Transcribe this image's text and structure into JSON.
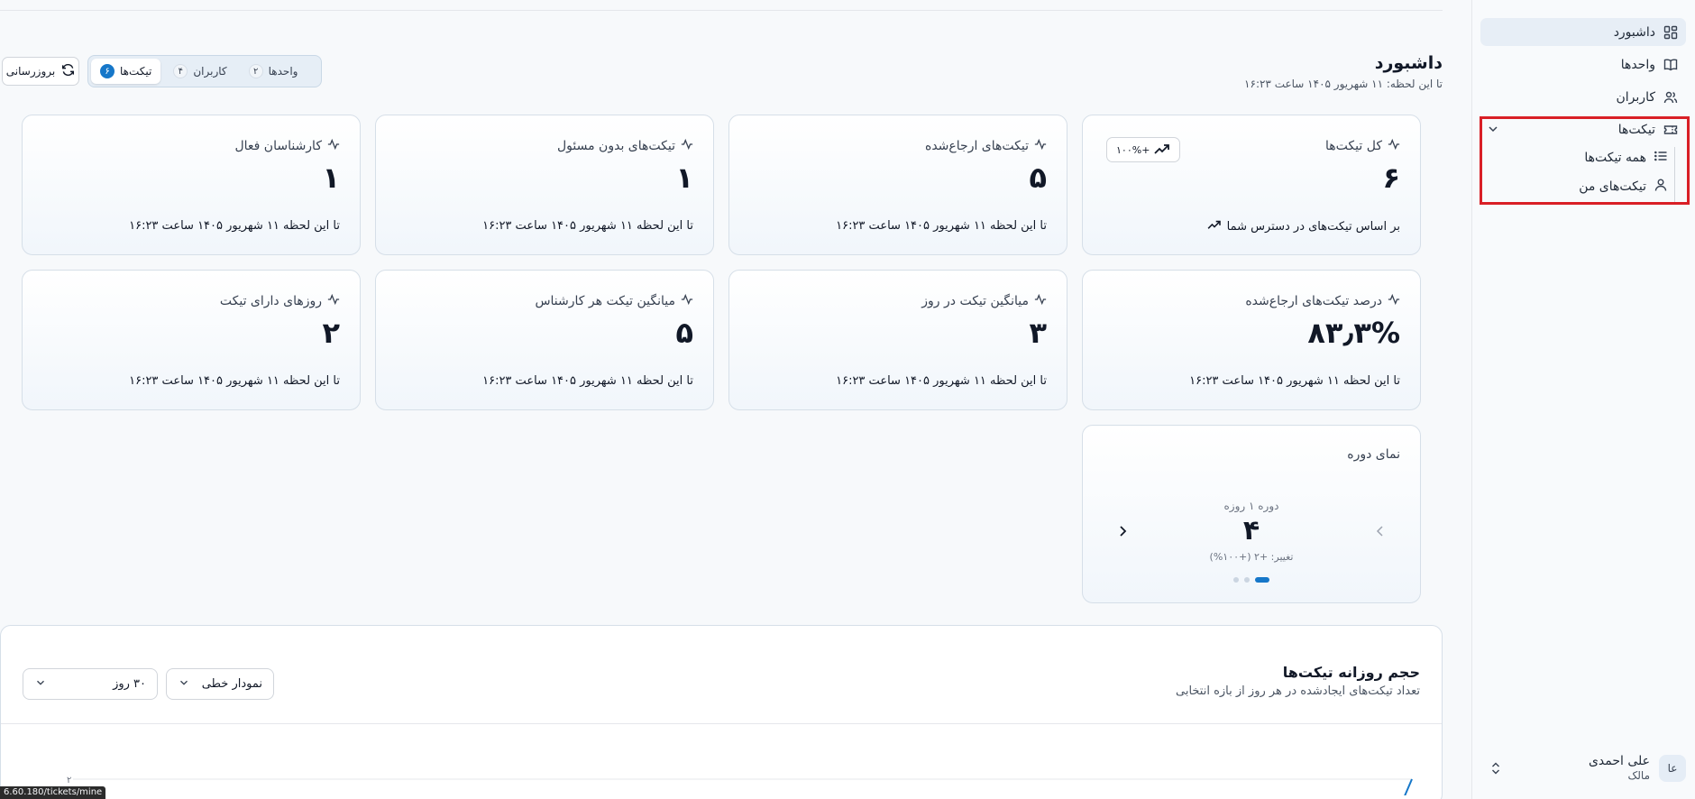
{
  "sidebar": {
    "items": [
      {
        "label": "داشبورد",
        "icon": "dashboard-icon"
      },
      {
        "label": "واحدها",
        "icon": "book-icon"
      },
      {
        "label": "کاربران",
        "icon": "users-icon"
      },
      {
        "label": "تیکت‌ها",
        "icon": "ticket-icon"
      }
    ],
    "sub_items": [
      {
        "label": "همه تیکت‌ها",
        "icon": "list-icon"
      },
      {
        "label": "تیکت‌های من",
        "icon": "user-icon"
      }
    ],
    "user": {
      "initials": "عا",
      "name": "علی احمدی",
      "role": "مالک"
    }
  },
  "header": {
    "title": "داشبورد",
    "subtitle": "تا این لحظه: ۱۱ شهریور ۱۴۰۵ ساعت ۱۶:۲۳",
    "refresh_label": "بروزرسانی",
    "tabs": [
      {
        "label": "تیکت‌ها",
        "count": "۶"
      },
      {
        "label": "کاربران",
        "count": "۴"
      },
      {
        "label": "واحدها",
        "count": "۲"
      }
    ]
  },
  "cards": [
    {
      "label": "کل تیکت‌ها",
      "value": "۶",
      "foot": "بر اساس تیکت‌های در دسترس شما",
      "trend": "+۱۰۰%"
    },
    {
      "label": "تیکت‌های ارجاع‌شده",
      "value": "۵",
      "foot": "تا این لحظه ۱۱ شهریور ۱۴۰۵ ساعت ۱۶:۲۳"
    },
    {
      "label": "تیکت‌های بدون مسئول",
      "value": "۱",
      "foot": "تا این لحظه ۱۱ شهریور ۱۴۰۵ ساعت ۱۶:۲۳"
    },
    {
      "label": "کارشناسان فعال",
      "value": "۱",
      "foot": "تا این لحظه ۱۱ شهریور ۱۴۰۵ ساعت ۱۶:۲۳"
    },
    {
      "label": "درصد تیکت‌های ارجاع‌شده",
      "value": "۸۳٫۳%",
      "foot": "تا این لحظه ۱۱ شهریور ۱۴۰۵ ساعت ۱۶:۲۳"
    },
    {
      "label": "میانگین تیکت در روز",
      "value": "۳",
      "foot": "تا این لحظه ۱۱ شهریور ۱۴۰۵ ساعت ۱۶:۲۳"
    },
    {
      "label": "میانگین تیکت هر کارشناس",
      "value": "۵",
      "foot": "تا این لحظه ۱۱ شهریور ۱۴۰۵ ساعت ۱۶:۲۳"
    },
    {
      "label": "روزهای دارای تیکت",
      "value": "۲",
      "foot": "تا این لحظه ۱۱ شهریور ۱۴۰۵ ساعت ۱۶:۲۳"
    }
  ],
  "period": {
    "title": "نمای دوره",
    "label": "دوره ۱ روزه",
    "value": "۴",
    "change": "تغییر: +۲ (+۱۰۰%)"
  },
  "chart_panel": {
    "title": "حجم روزانه تیکت‌ها",
    "subtitle": "تعداد تیکت‌های ایجادشده در هر روز از بازه انتخابی",
    "chart_type_select": "نمودار خطی",
    "range_select": "۳۰ روز",
    "y_tick_top": "۲"
  },
  "chart_data": {
    "type": "line",
    "title": "حجم روزانه تیکت‌ها",
    "xlabel": "",
    "ylabel": "",
    "y_ticks": [
      "۲"
    ],
    "series": [
      {
        "values": [
          2
        ]
      }
    ],
    "grid": true
  },
  "status_url": "6.60.180/tickets/mine",
  "colors": {
    "accent": "#1677c9",
    "highlight": "#d91f26",
    "active_nav": "#e7eef6"
  }
}
